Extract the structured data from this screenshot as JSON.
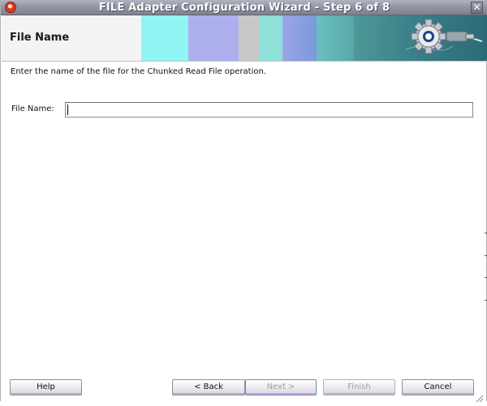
{
  "window": {
    "title": "FILE Adapter Configuration Wizard - Step 6 of 8",
    "close_glyph": "✕"
  },
  "header": {
    "title": "File Name"
  },
  "body": {
    "instruction": "Enter the name of the file for the Chunked Read File operation.",
    "file_name_label": "File Name:",
    "file_name_value": "",
    "file_name_placeholder": ""
  },
  "buttons": {
    "help": "Help",
    "back": "< Back",
    "next": "Next >",
    "finish": "Finish",
    "cancel": "Cancel"
  },
  "colors": {
    "titlebar": "#8f94a3",
    "header_background": "#f3f3f3",
    "accent_teal": "#3a7f8a"
  },
  "icons": {
    "app": "oracle-logo-icon",
    "header": "gear-plug-icon",
    "close": "close-icon",
    "resize": "resize-grip-icon"
  }
}
